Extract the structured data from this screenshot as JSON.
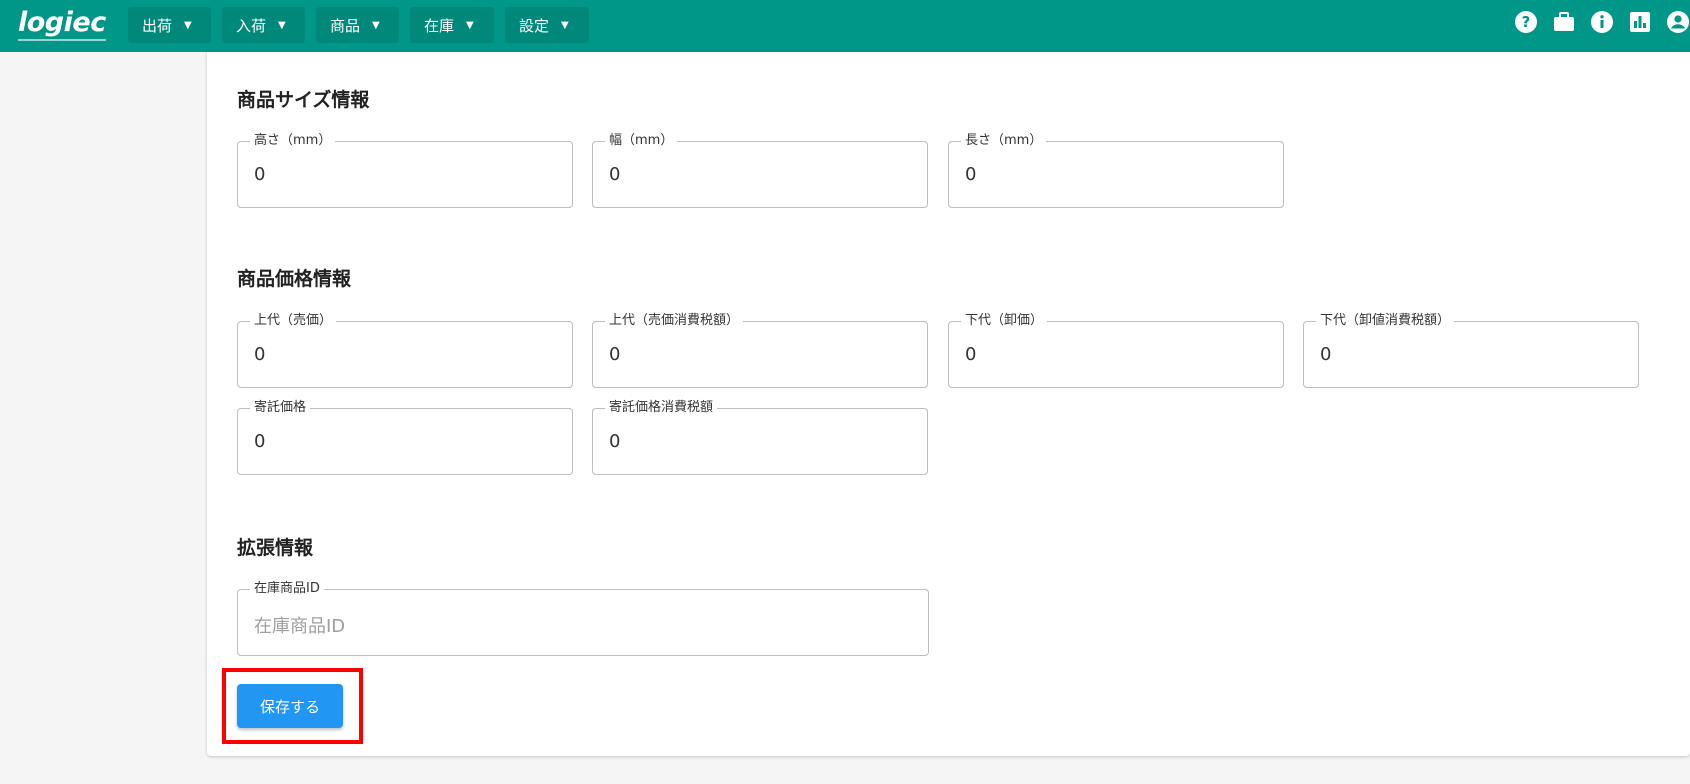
{
  "header": {
    "logo": "logiec",
    "nav": [
      {
        "label": "出荷",
        "caret": "▼"
      },
      {
        "label": "入荷",
        "caret": "▼"
      },
      {
        "label": "商品",
        "caret": "▼"
      },
      {
        "label": "在庫",
        "caret": "▼"
      },
      {
        "label": "設定",
        "caret": "▼"
      }
    ],
    "icons": [
      "help-icon",
      "briefcase-icon",
      "info-icon",
      "chart-icon",
      "account-icon"
    ]
  },
  "sections": {
    "size": {
      "title": "商品サイズ情報",
      "fields": [
        {
          "label": "高さ（mm）",
          "value": "0"
        },
        {
          "label": "幅（mm）",
          "value": "0"
        },
        {
          "label": "長さ（mm）",
          "value": "0"
        }
      ]
    },
    "price": {
      "title": "商品価格情報",
      "fields": [
        {
          "label": "上代（売価）",
          "value": "0"
        },
        {
          "label": "上代（売価消費税額）",
          "value": "0"
        },
        {
          "label": "下代（卸価）",
          "value": "0"
        },
        {
          "label": "下代（卸値消費税額）",
          "value": "0"
        },
        {
          "label": "寄託価格",
          "value": "0"
        },
        {
          "label": "寄託価格消費税額",
          "value": "0"
        }
      ]
    },
    "extended": {
      "title": "拡張情報",
      "fields": [
        {
          "label": "在庫商品ID",
          "placeholder": "在庫商品ID"
        }
      ]
    }
  },
  "actions": {
    "save_label": "保存する"
  },
  "colors": {
    "header": "#009688",
    "primary": "#2196f3",
    "highlight": "#ff0000"
  }
}
